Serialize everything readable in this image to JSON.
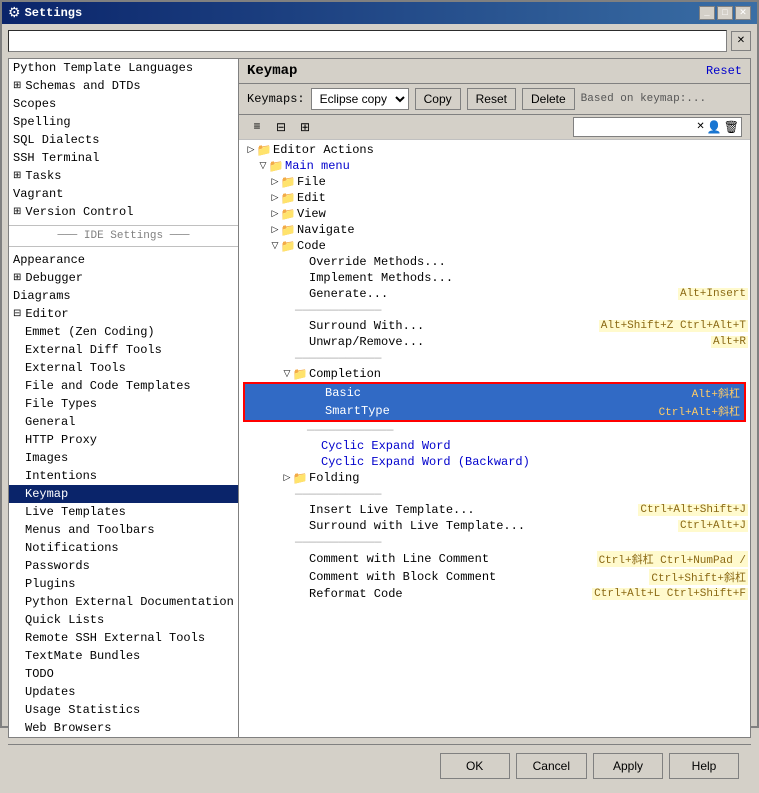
{
  "window": {
    "title": "Settings",
    "icon": "⚙"
  },
  "search": {
    "placeholder": "",
    "clear_label": "✕"
  },
  "sidebar": {
    "items": [
      {
        "label": "Python Template Languages",
        "level": 1,
        "expandable": false,
        "active": false
      },
      {
        "label": "Schemas and DTDs",
        "level": 1,
        "expandable": true,
        "active": false
      },
      {
        "label": "Scopes",
        "level": 1,
        "expandable": false,
        "active": false
      },
      {
        "label": "Spelling",
        "level": 1,
        "expandable": false,
        "active": false
      },
      {
        "label": "SQL Dialects",
        "level": 1,
        "expandable": false,
        "active": false
      },
      {
        "label": "SSH Terminal",
        "level": 1,
        "expandable": false,
        "active": false
      },
      {
        "label": "Tasks",
        "level": 1,
        "expandable": true,
        "active": false
      },
      {
        "label": "Vagrant",
        "level": 1,
        "expandable": false,
        "active": false
      },
      {
        "label": "Version Control",
        "level": 1,
        "expandable": true,
        "active": false
      },
      {
        "label": "IDE Settings",
        "section": true
      },
      {
        "label": "Appearance",
        "level": 1,
        "expandable": false,
        "active": false
      },
      {
        "label": "Debugger",
        "level": 1,
        "expandable": true,
        "active": false
      },
      {
        "label": "Diagrams",
        "level": 1,
        "expandable": false,
        "active": false
      },
      {
        "label": "Editor",
        "level": 1,
        "expandable": true,
        "active": false
      },
      {
        "label": "Emmet (Zen Coding)",
        "level": 2,
        "expandable": false,
        "active": false
      },
      {
        "label": "External Diff Tools",
        "level": 2,
        "expandable": false,
        "active": false
      },
      {
        "label": "External Tools",
        "level": 2,
        "expandable": false,
        "active": false
      },
      {
        "label": "File and Code Templates",
        "level": 2,
        "expandable": false,
        "active": false
      },
      {
        "label": "File Types",
        "level": 2,
        "expandable": false,
        "active": false
      },
      {
        "label": "General",
        "level": 2,
        "expandable": false,
        "active": false
      },
      {
        "label": "HTTP Proxy",
        "level": 2,
        "expandable": false,
        "active": false
      },
      {
        "label": "Images",
        "level": 2,
        "expandable": false,
        "active": false
      },
      {
        "label": "Intentions",
        "level": 2,
        "expandable": false,
        "active": false
      },
      {
        "label": "Keymap",
        "level": 2,
        "expandable": false,
        "active": true
      },
      {
        "label": "Live Templates",
        "level": 2,
        "expandable": false,
        "active": false
      },
      {
        "label": "Menus and Toolbars",
        "level": 2,
        "expandable": false,
        "active": false
      },
      {
        "label": "Notifications",
        "level": 2,
        "expandable": false,
        "active": false
      },
      {
        "label": "Passwords",
        "level": 2,
        "expandable": false,
        "active": false
      },
      {
        "label": "Plugins",
        "level": 2,
        "expandable": false,
        "active": false
      },
      {
        "label": "Python External Documentation",
        "level": 2,
        "expandable": false,
        "active": false
      },
      {
        "label": "Quick Lists",
        "level": 2,
        "expandable": false,
        "active": false
      },
      {
        "label": "Remote SSH External Tools",
        "level": 2,
        "expandable": false,
        "active": false
      },
      {
        "label": "TextMate Bundles",
        "level": 2,
        "expandable": false,
        "active": false
      },
      {
        "label": "TODO",
        "level": 2,
        "expandable": false,
        "active": false
      },
      {
        "label": "Updates",
        "level": 2,
        "expandable": false,
        "active": false
      },
      {
        "label": "Usage Statistics",
        "level": 2,
        "expandable": false,
        "active": false
      },
      {
        "label": "Web Browsers",
        "level": 2,
        "expandable": false,
        "active": false
      }
    ]
  },
  "keymap": {
    "title": "Keymap",
    "reset_label": "Reset",
    "keymaps_label": "Keymaps:",
    "selected_keymap": "Eclipse copy",
    "copy_label": "Copy",
    "reset_btn_label": "Reset",
    "delete_label": "Delete",
    "based_on_label": "Based on keymap:..."
  },
  "toolbar": {
    "icon1": "≡",
    "icon2": "⊟",
    "icon3": "⊞"
  },
  "tree": {
    "nodes": [
      {
        "label": "Editor Actions",
        "indent": 1,
        "type": "expand",
        "folder": true,
        "shortcut": ""
      },
      {
        "label": "Main menu",
        "indent": 2,
        "type": "expanded",
        "folder": true,
        "shortcut": "",
        "color": "blue"
      },
      {
        "label": "File",
        "indent": 3,
        "type": "expand",
        "folder": true,
        "shortcut": ""
      },
      {
        "label": "Edit",
        "indent": 3,
        "type": "expand",
        "folder": true,
        "shortcut": ""
      },
      {
        "label": "View",
        "indent": 3,
        "type": "expand",
        "folder": true,
        "shortcut": ""
      },
      {
        "label": "Navigate",
        "indent": 3,
        "type": "expand",
        "folder": true,
        "shortcut": ""
      },
      {
        "label": "Code",
        "indent": 3,
        "type": "expanded",
        "folder": true,
        "shortcut": ""
      },
      {
        "label": "Override Methods...",
        "indent": 4,
        "type": "leaf",
        "folder": false,
        "shortcut": ""
      },
      {
        "label": "Implement Methods...",
        "indent": 4,
        "type": "leaf",
        "folder": false,
        "shortcut": ""
      },
      {
        "label": "Generate...",
        "indent": 4,
        "type": "leaf",
        "folder": false,
        "shortcut": "Alt+Insert"
      },
      {
        "label": "————————————",
        "indent": 4,
        "type": "separator",
        "folder": false,
        "shortcut": ""
      },
      {
        "label": "Surround With...",
        "indent": 4,
        "type": "leaf",
        "folder": false,
        "shortcut": "Alt+Shift+Z  Ctrl+Alt+T"
      },
      {
        "label": "Unwrap/Remove...",
        "indent": 4,
        "type": "leaf",
        "folder": false,
        "shortcut": "Alt+R"
      },
      {
        "label": "————————————",
        "indent": 4,
        "type": "separator",
        "folder": false,
        "shortcut": ""
      },
      {
        "label": "Completion",
        "indent": 4,
        "type": "expanded",
        "folder": true,
        "shortcut": ""
      },
      {
        "label": "Basic",
        "indent": 5,
        "type": "leaf",
        "folder": false,
        "shortcut": "Alt+斜杠",
        "selected": true
      },
      {
        "label": "SmartType",
        "indent": 5,
        "type": "leaf",
        "folder": false,
        "shortcut": "Ctrl+Alt+斜杠",
        "selected": true
      },
      {
        "label": "————————————",
        "indent": 5,
        "type": "separator",
        "folder": false,
        "shortcut": ""
      },
      {
        "label": "Cyclic Expand Word",
        "indent": 5,
        "type": "leaf",
        "folder": false,
        "shortcut": "",
        "color": "blue"
      },
      {
        "label": "Cyclic Expand Word (Backward)",
        "indent": 5,
        "type": "leaf",
        "folder": false,
        "shortcut": "",
        "color": "blue"
      },
      {
        "label": "Folding",
        "indent": 4,
        "type": "expand",
        "folder": true,
        "shortcut": ""
      },
      {
        "label": "————————————",
        "indent": 4,
        "type": "separator",
        "folder": false,
        "shortcut": ""
      },
      {
        "label": "Insert Live Template...",
        "indent": 4,
        "type": "leaf",
        "folder": false,
        "shortcut": "Ctrl+Alt+Shift+J"
      },
      {
        "label": "Surround with Live Template...",
        "indent": 4,
        "type": "leaf",
        "folder": false,
        "shortcut": "Ctrl+Alt+J"
      },
      {
        "label": "————————————",
        "indent": 4,
        "type": "separator",
        "folder": false,
        "shortcut": ""
      },
      {
        "label": "Comment with Line Comment",
        "indent": 4,
        "type": "leaf",
        "folder": false,
        "shortcut": "Ctrl+斜杠  Ctrl+NumPad /"
      },
      {
        "label": "Comment with Block Comment",
        "indent": 4,
        "type": "leaf",
        "folder": false,
        "shortcut": "Ctrl+Shift+斜杠"
      },
      {
        "label": "Reformat Code",
        "indent": 4,
        "type": "leaf",
        "folder": false,
        "shortcut": "Ctrl+Alt+L  Ctrl+Shift+F"
      }
    ]
  },
  "buttons": {
    "ok_label": "OK",
    "cancel_label": "Cancel",
    "apply_label": "Apply",
    "help_label": "Help"
  }
}
